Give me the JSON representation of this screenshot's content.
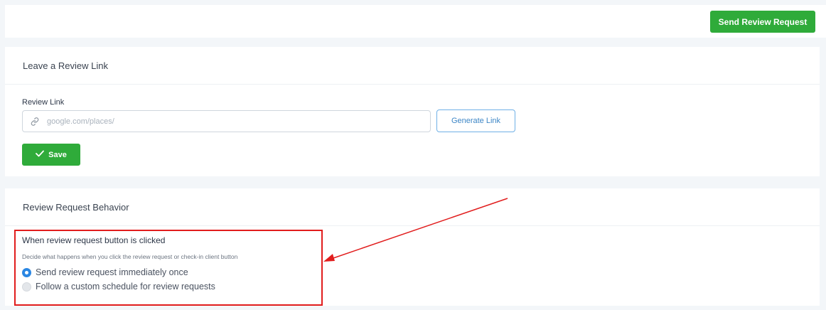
{
  "header": {
    "send_review_label": "Send Review Request"
  },
  "review_link_card": {
    "title": "Leave a Review Link",
    "field_label": "Review Link",
    "input_value": "",
    "input_placeholder": "google.com/places/",
    "generate_label": "Generate Link",
    "save_label": "Save"
  },
  "behavior_card": {
    "title": "Review Request Behavior",
    "question": "When review request button is clicked",
    "description": "Decide what happens when you click the review request or check-in client button",
    "options": [
      {
        "label": "Send review request immediately once",
        "selected": true
      },
      {
        "label": "Follow a custom schedule for review requests",
        "selected": false
      }
    ]
  },
  "colors": {
    "primary_green": "#2fab3a",
    "radio_blue": "#2b87e3",
    "outline_blue": "#3d86c6",
    "annotation_red": "#e11d1d"
  },
  "icons": {
    "link": "link-icon",
    "check": "check-icon"
  }
}
